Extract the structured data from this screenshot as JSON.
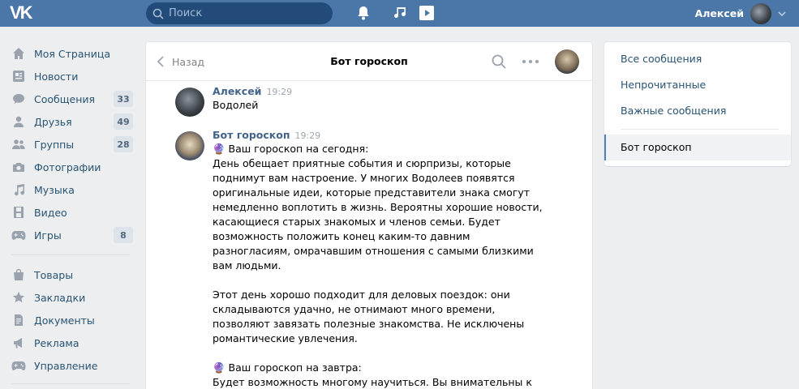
{
  "header": {
    "logo": "VK",
    "search_placeholder": "Поиск",
    "user_name": "Алексей"
  },
  "sidebar": {
    "items": [
      {
        "label": "Моя Страница",
        "icon": "home-icon"
      },
      {
        "label": "Новости",
        "icon": "news-icon"
      },
      {
        "label": "Сообщения",
        "icon": "messages-icon",
        "count": "33"
      },
      {
        "label": "Друзья",
        "icon": "friend-icon",
        "count": "49"
      },
      {
        "label": "Группы",
        "icon": "groups-icon",
        "count": "28"
      },
      {
        "label": "Фотографии",
        "icon": "camera-icon"
      },
      {
        "label": "Музыка",
        "icon": "music-icon"
      },
      {
        "label": "Видео",
        "icon": "film-icon"
      },
      {
        "label": "Игры",
        "icon": "gamepad-icon",
        "count": "8"
      }
    ],
    "items2": [
      {
        "label": "Товары",
        "icon": "bag-icon"
      },
      {
        "label": "Закладки",
        "icon": "star-icon"
      },
      {
        "label": "Документы",
        "icon": "document-icon"
      },
      {
        "label": "Реклама",
        "icon": "megaphone-icon"
      },
      {
        "label": "Управление",
        "icon": "gamepad-icon"
      }
    ]
  },
  "chat": {
    "back_label": "Назад",
    "title": "Бот гороскоп",
    "messages": [
      {
        "author": "Алексей",
        "time": "19:29",
        "lines": [
          "Водолей"
        ]
      },
      {
        "author": "Бот гороскоп",
        "time": "19:29",
        "lines": [
          "🔮 Ваш гороскоп на сегодня:",
          "День обещает приятные события и сюрпризы, которые",
          "поднимут вам настроение. У многих Водолеев появятся",
          "оригинальные идеи, которые представители знака смогут",
          "немедленно воплотить в жизнь. Вероятны хорошие новости,",
          "касающиеся старых знакомых и членов семьи. Будет",
          "возможность положить конец каким-то давним",
          "разногласиям, омрачавшим отношения с самыми близкими",
          "вам людьми.",
          "",
          "Этот день хорошо подходит для деловых поездок: они",
          "складываются удачно, не отнимают много времени,",
          "позволяют завязать полезные знакомства. Не исключены",
          "романтические увлечения.",
          "",
          "🔮 Ваш гороскоп на завтра:",
          "Будет возможность многому научиться. Вы внимательны к"
        ]
      }
    ]
  },
  "right_panel": {
    "filters": [
      "Все сообщения",
      "Непрочитанные",
      "Важные сообщения"
    ],
    "active_chat": "Бот гороскоп"
  },
  "colors": {
    "header_bg": "#4a76a8",
    "link": "#285473",
    "author": "#42648b",
    "page_bg": "#edeef0"
  }
}
